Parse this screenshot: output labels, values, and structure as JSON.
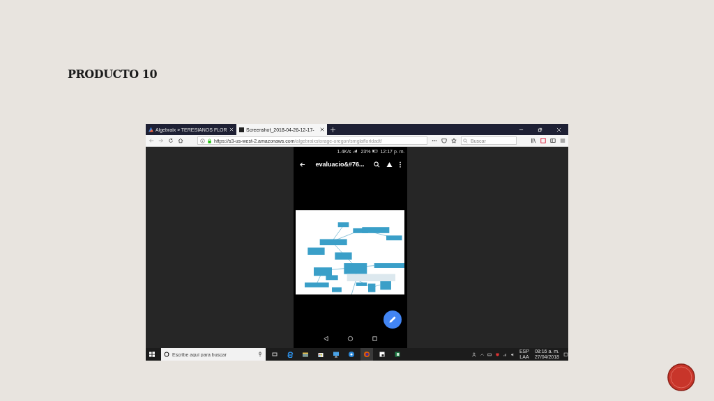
{
  "slide": {
    "title": "PRODUCTO 10"
  },
  "browser": {
    "tabs": [
      {
        "label": "Algebraix » TERESIANOS FLOR",
        "selected": false
      },
      {
        "label": "Screenshot_2018-04-26-12-17-",
        "selected": true
      }
    ],
    "url": {
      "host": "https://s3-us-west-2.amazonaws.com",
      "path": "/algebraixstorage-oregon/smglafloridadt/"
    },
    "search": {
      "placeholder": "Buscar"
    }
  },
  "phone": {
    "status": {
      "speed": "1.4K/s",
      "battery": "23%",
      "time": "12:17 p. m."
    },
    "app_bar": {
      "title": "evaluacio&#76..."
    }
  },
  "taskbar": {
    "search": {
      "placeholder": "Escribe aquí para buscar"
    },
    "language": "ESP",
    "layout": "LAA",
    "time": "08:16 a. m.",
    "date": "27/04/2018"
  }
}
